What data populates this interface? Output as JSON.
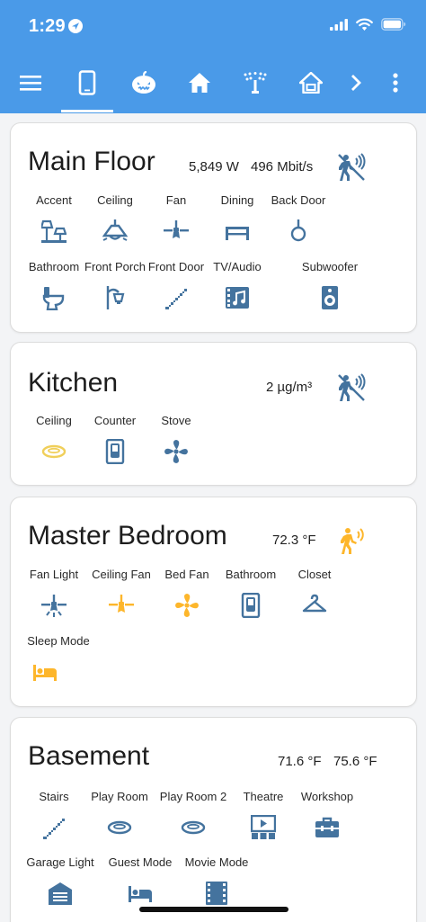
{
  "status_bar": {
    "time": "1:29"
  },
  "colors": {
    "header": "#4a9ae8",
    "icon_off": "#44739e",
    "icon_on": "#fdb62b",
    "icon_on_light": "#f0cf5a"
  },
  "toolbar": {
    "icons": [
      "menu-icon",
      "cellphone-icon",
      "pumpkin-icon",
      "home-icon",
      "sprinkler-icon",
      "home-alert-icon",
      "chevron-right-icon",
      "more-vertical-icon"
    ]
  },
  "cards": {
    "main_floor": {
      "title": "Main Floor",
      "stats": [
        "5,849 W",
        "496 Mbit/s"
      ],
      "tiles": [
        {
          "label": "Accent",
          "icon": "accent-lamps-icon",
          "state": "off"
        },
        {
          "label": "Ceiling",
          "icon": "ceiling-light-icon",
          "state": "off"
        },
        {
          "label": "Fan",
          "icon": "ceiling-fan-icon",
          "state": "off"
        },
        {
          "label": "Dining",
          "icon": "table-light-icon",
          "state": "off"
        },
        {
          "label": "Back Door",
          "icon": "door-hook-icon",
          "state": "off"
        },
        {
          "label": "Bathroom",
          "icon": "toilet-icon",
          "state": "off"
        },
        {
          "label": "Front Porch",
          "icon": "outdoor-lamp-icon",
          "state": "off"
        },
        {
          "label": "Front Door",
          "icon": "stairs-icon",
          "state": "off"
        },
        {
          "label": "TV/Audio",
          "icon": "audio-video-icon",
          "state": "off"
        },
        {
          "label": "Subwoofer",
          "icon": "speaker-icon",
          "state": "off"
        }
      ]
    },
    "kitchen": {
      "title": "Kitchen",
      "stats": [
        "2 µg/m³"
      ],
      "tiles": [
        {
          "label": "Ceiling",
          "icon": "ceiling-ring-light-icon",
          "state": "on"
        },
        {
          "label": "Counter",
          "icon": "light-switch-icon",
          "state": "off"
        },
        {
          "label": "Stove",
          "icon": "fan-icon",
          "state": "off"
        }
      ]
    },
    "master_bedroom": {
      "title": "Master Bedroom",
      "stats": [
        "72.3 °F"
      ],
      "tiles": [
        {
          "label": "Fan Light",
          "icon": "ceiling-fan-light-icon",
          "state": "off"
        },
        {
          "label": "Ceiling Fan",
          "icon": "ceiling-fan-icon",
          "state": "on"
        },
        {
          "label": "Bed Fan",
          "icon": "fan-icon",
          "state": "on"
        },
        {
          "label": "Bathroom",
          "icon": "light-switch-icon",
          "state": "off"
        },
        {
          "label": "Closet",
          "icon": "hanger-icon",
          "state": "off"
        },
        {
          "label": "Sleep Mode",
          "icon": "bed-icon",
          "state": "on"
        }
      ]
    },
    "basement": {
      "title": "Basement",
      "stats": [
        "71.6 °F",
        "75.6 °F"
      ],
      "tiles": [
        {
          "label": "Stairs",
          "icon": "stairs-icon",
          "state": "off"
        },
        {
          "label": "Play Room",
          "icon": "ceiling-ring-light-icon",
          "state": "off"
        },
        {
          "label": "Play Room 2",
          "icon": "ceiling-ring-light-icon",
          "state": "off"
        },
        {
          "label": "Theatre",
          "icon": "theater-icon",
          "state": "off"
        },
        {
          "label": "Workshop",
          "icon": "toolbox-icon",
          "state": "off"
        },
        {
          "label": "Garage Light",
          "icon": "garage-icon",
          "state": "off"
        },
        {
          "label": "Guest Mode",
          "icon": "bed-icon",
          "state": "off"
        },
        {
          "label": "Movie Mode",
          "icon": "film-icon",
          "state": "off"
        }
      ]
    }
  }
}
